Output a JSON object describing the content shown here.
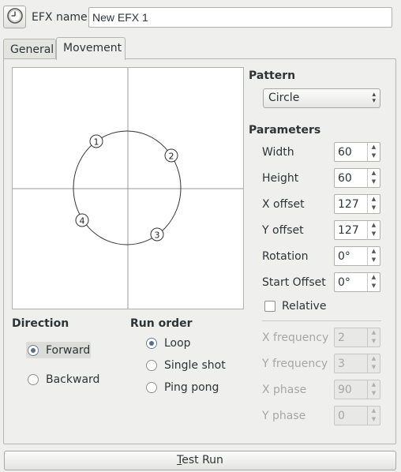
{
  "header": {
    "clock_icon": "clock-icon",
    "name_label": "EFX name",
    "name_value": "New EFX 1"
  },
  "tabs": [
    {
      "label": "General",
      "active": false
    },
    {
      "label": "Movement",
      "active": true
    }
  ],
  "preview": {
    "points": [
      "1",
      "2",
      "3",
      "4"
    ]
  },
  "pattern": {
    "title": "Pattern",
    "selected": "Circle"
  },
  "parameters": {
    "title": "Parameters",
    "width": {
      "label": "Width",
      "value": "60"
    },
    "height": {
      "label": "Height",
      "value": "60"
    },
    "x_offset": {
      "label": "X offset",
      "value": "127"
    },
    "y_offset": {
      "label": "Y offset",
      "value": "127"
    },
    "rotation": {
      "label": "Rotation",
      "value": "0°"
    },
    "start_offset": {
      "label": "Start Offset",
      "value": "0°"
    },
    "relative": {
      "label": "Relative",
      "checked": false
    },
    "x_frequency": {
      "label": "X frequency",
      "value": "2"
    },
    "y_frequency": {
      "label": "Y frequency",
      "value": "3"
    },
    "x_phase": {
      "label": "X phase",
      "value": "90"
    },
    "y_phase": {
      "label": "Y phase",
      "value": "0"
    }
  },
  "direction": {
    "title": "Direction",
    "forward": "Forward",
    "backward": "Backward",
    "selected": "Forward"
  },
  "run_order": {
    "title": "Run order",
    "loop": "Loop",
    "single_shot": "Single shot",
    "ping_pong": "Ping pong",
    "selected": "Loop"
  },
  "test_run": {
    "mnemonic": "T",
    "rest": "est Run"
  },
  "colors": {
    "window_bg": "#efefee",
    "radio_dot": "#5a6d88"
  }
}
